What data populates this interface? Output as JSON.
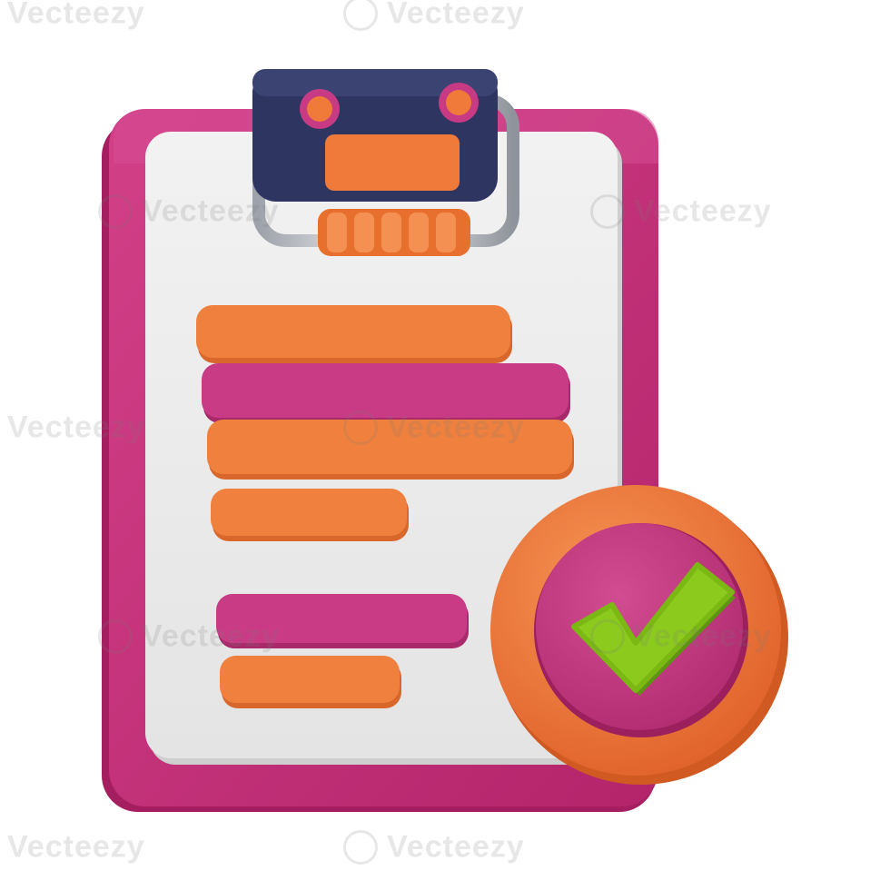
{
  "image": {
    "subject": "3D clipboard with approved checkmark badge",
    "colors": {
      "board": "#C7307A",
      "board_edge": "#A81F63",
      "paper": "#EEEEEE",
      "clip_body": "#2E3560",
      "clip_accent": "#F07A3A",
      "clip_metal": "#C9CCD3",
      "line_orange": "#F0803D",
      "line_pink": "#C93C85",
      "badge_ring": "#F07A3A",
      "badge_inner": "#C83A84",
      "check": "#8CCB1E"
    },
    "icons": [
      "clipboard-icon",
      "check-badge-icon",
      "checkmark-icon"
    ]
  },
  "watermark": {
    "text": "Vecteezy"
  }
}
